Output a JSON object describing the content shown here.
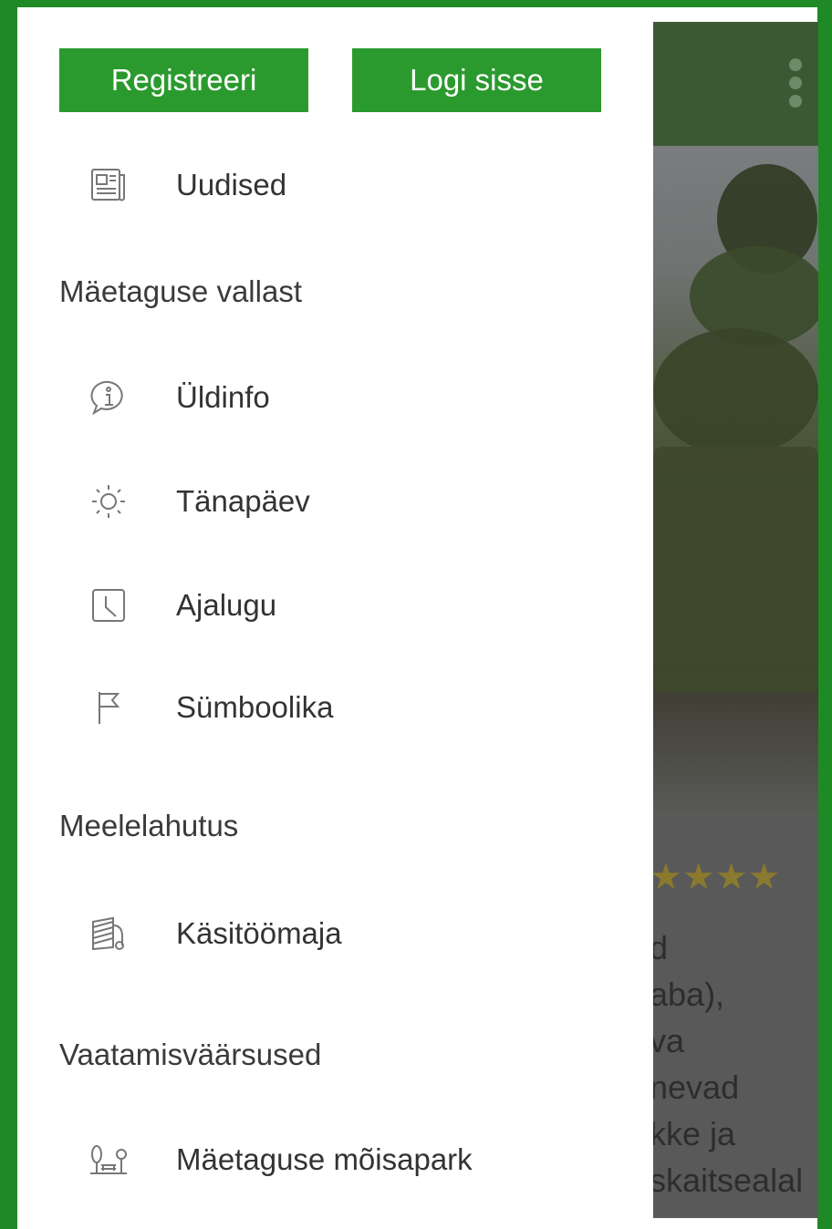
{
  "drawer": {
    "buttons": {
      "register": "Registreeri",
      "login": "Logi sisse"
    },
    "news": {
      "label": "Uudised",
      "icon": "newspaper-icon"
    },
    "sections": [
      {
        "title": "Mäetaguse vallast",
        "items": [
          {
            "label": "Üldinfo",
            "icon": "info-icon"
          },
          {
            "label": "Tänapäev",
            "icon": "sun-icon"
          },
          {
            "label": "Ajalugu",
            "icon": "clock-icon"
          },
          {
            "label": "Sümboolika",
            "icon": "flag-icon"
          }
        ]
      },
      {
        "title": "Meelelahutus",
        "items": [
          {
            "label": "Käsitöömaja",
            "icon": "yarn-icon"
          }
        ]
      },
      {
        "title": "Vaatamisväärsused",
        "items": [
          {
            "label": "Mäetaguse mõisapark",
            "icon": "park-icon"
          }
        ]
      }
    ]
  },
  "background_app": {
    "rating_stars": "★★★★",
    "text_lines": [
      "d",
      "aba),",
      "va",
      "nevad",
      "kke ja",
      "skaitsealal"
    ]
  },
  "colors": {
    "frame": "#1f8a25",
    "button": "#2b9a2e",
    "toolbar": "#3a5a34"
  }
}
